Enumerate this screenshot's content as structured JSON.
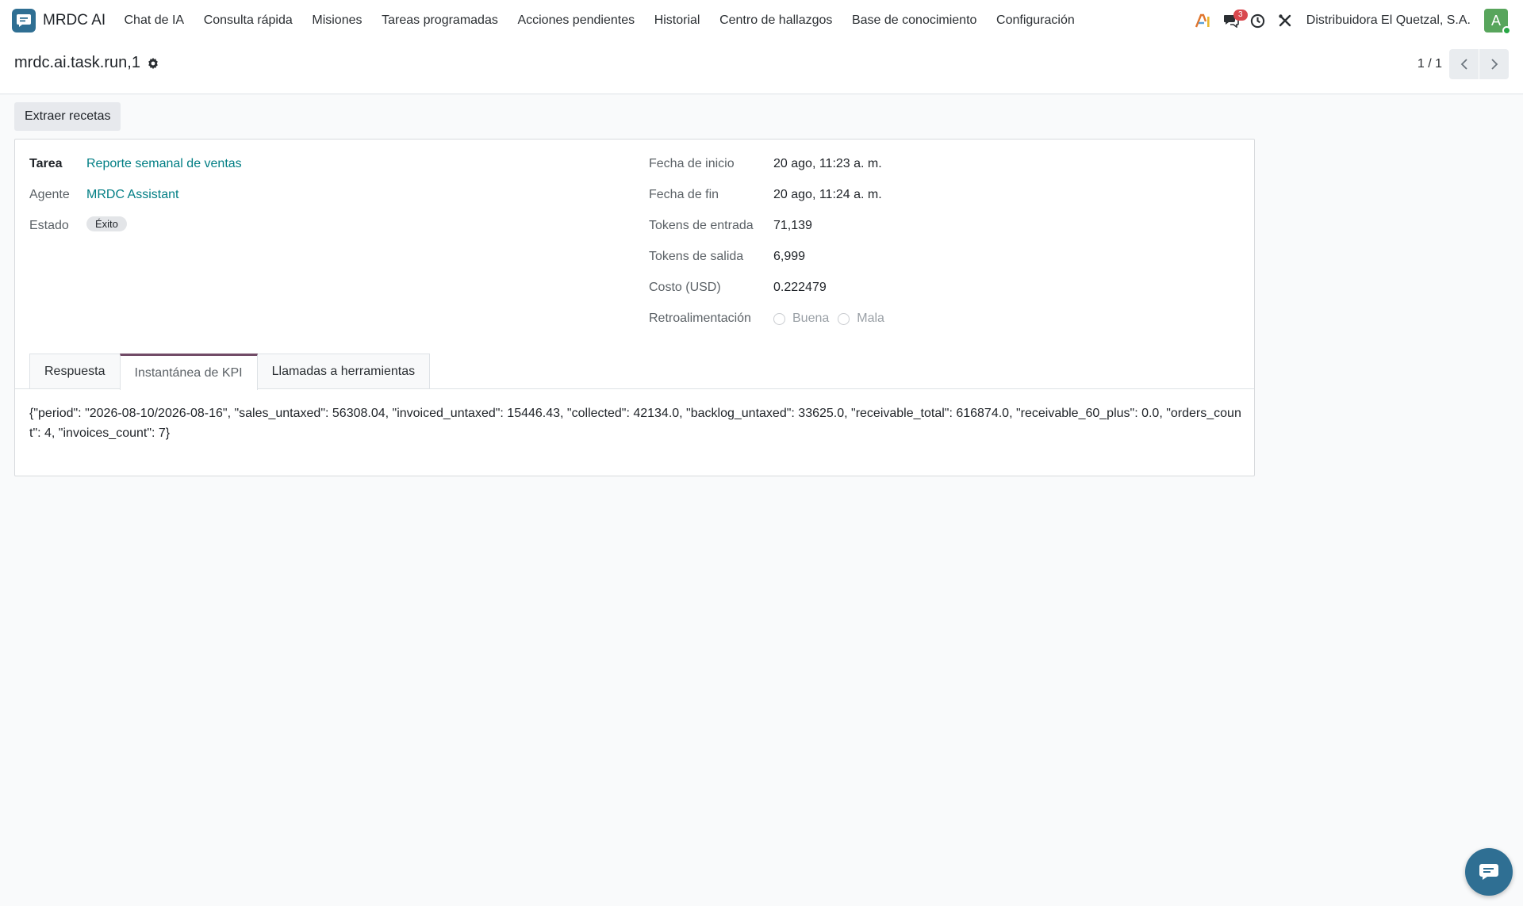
{
  "app": {
    "name": "MRDC AI"
  },
  "menu": [
    {
      "label": "Chat de IA"
    },
    {
      "label": "Consulta rápida"
    },
    {
      "label": "Misiones"
    },
    {
      "label": "Tareas programadas"
    },
    {
      "label": "Acciones pendientes"
    },
    {
      "label": "Historial"
    },
    {
      "label": "Centro de hallazgos"
    },
    {
      "label": "Base de conocimiento"
    },
    {
      "label": "Configuración"
    }
  ],
  "systray": {
    "messages_count": "3",
    "company": "Distribuidora El Quetzal, S.A.",
    "avatar_initial": "A",
    "avatar_color": "#58a55c"
  },
  "record": {
    "title": "mrdc.ai.task.run,1"
  },
  "pager": {
    "value": "1 / 1"
  },
  "actions": {
    "extract_recipes": "Extraer recetas"
  },
  "fields": {
    "task": {
      "label": "Tarea",
      "value": "Reporte semanal de ventas"
    },
    "agent": {
      "label": "Agente",
      "value": "MRDC Assistant"
    },
    "status": {
      "label": "Estado",
      "value": "Éxito"
    },
    "start_date": {
      "label": "Fecha de inicio",
      "value": "20 ago, 11:23 a. m."
    },
    "end_date": {
      "label": "Fecha de fin",
      "value": "20 ago, 11:24 a. m."
    },
    "tokens_in": {
      "label": "Tokens de entrada",
      "value": "71,139"
    },
    "tokens_out": {
      "label": "Tokens de salida",
      "value": "6,999"
    },
    "cost": {
      "label": "Costo (USD)",
      "value": "0.222479"
    },
    "feedback": {
      "label": "Retroalimentación",
      "options": [
        "Buena",
        "Mala"
      ]
    }
  },
  "tabs": [
    {
      "label": "Respuesta",
      "active": false
    },
    {
      "label": "Instantánea de KPI",
      "active": true
    },
    {
      "label": "Llamadas a herramientas",
      "active": false
    }
  ],
  "kpi_snapshot": "{\"period\": \"2026-08-10/2026-08-16\", \"sales_untaxed\": 56308.04, \"invoiced_untaxed\": 15446.43, \"collected\": 42134.0, \"backlog_untaxed\": 33625.0, \"receivable_total\": 616874.0, \"receivable_60_plus\": 0.0, \"orders_count\": 4, \"invoices_count\": 7}",
  "colors": {
    "brand": "#2f6f93",
    "link": "#017e84",
    "active_tab": "#714b67",
    "badge": "#d9484e"
  }
}
